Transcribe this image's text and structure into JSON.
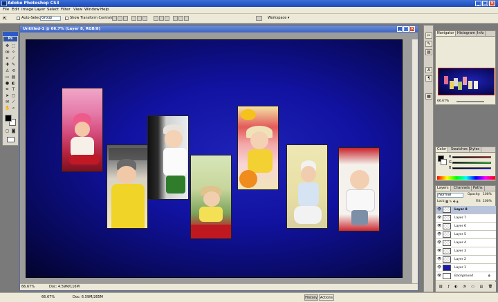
{
  "app": {
    "title": "Adobe Photoshop CS3",
    "window_buttons": [
      "_",
      "□",
      "×"
    ]
  },
  "menu": [
    "File",
    "Edit",
    "Image",
    "Layer",
    "Select",
    "Filter",
    "View",
    "Window",
    "Help"
  ],
  "options_bar": {
    "auto_select_label": "Auto-Select:",
    "auto_select_value": "Group",
    "show_transform_label": "Show Transform Controls",
    "workspace_label": "Workspace ▾"
  },
  "tools": {
    "logo": "Ps"
  },
  "document": {
    "title": "Untitled-1 @ 66.7% (Layer 8, RGB/8)",
    "status_zoom": "66.67%",
    "status_doc": "Doc: 4.59M/116M",
    "background_colors": [
      "#1f22b8",
      "#03032c"
    ]
  },
  "bottom_bar": {
    "zoom": "66.67%",
    "doc": "Doc: 6.59M/265M",
    "tab_history": "History",
    "tab_actions": "Actions"
  },
  "navigator": {
    "tabs": [
      "Navigator",
      "Histogram",
      "Info"
    ],
    "zoom": "66.67%"
  },
  "color": {
    "tabs": [
      "Color",
      "Swatches",
      "Styles"
    ],
    "channels": [
      "R",
      "G",
      "B"
    ],
    "foreground": "#000000",
    "background": "#ffffff"
  },
  "layers": {
    "tabs": [
      "Layers",
      "Channels",
      "Paths"
    ],
    "blend_mode": "Normal",
    "opacity_label": "Opacity:",
    "opacity_value": "100%",
    "lock_label": "Lock:",
    "fill_label": "Fill:",
    "fill_value": "100%",
    "items": [
      {
        "name": "Layer 8",
        "selected": true
      },
      {
        "name": "Layer 7",
        "selected": false
      },
      {
        "name": "Layer 6",
        "selected": false
      },
      {
        "name": "Layer 5",
        "selected": false
      },
      {
        "name": "Layer 4",
        "selected": false
      },
      {
        "name": "Layer 3",
        "selected": false
      },
      {
        "name": "Layer 2",
        "selected": false
      },
      {
        "name": "Layer 1",
        "selected": false
      },
      {
        "name": "Background",
        "selected": false
      }
    ]
  }
}
